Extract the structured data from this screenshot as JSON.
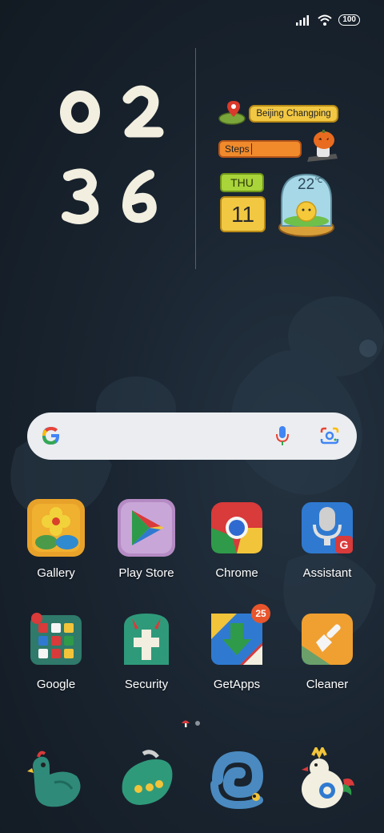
{
  "status_bar": {
    "battery": "100"
  },
  "clock": {
    "digits": [
      "0",
      "2",
      "3",
      "6"
    ]
  },
  "widgets": {
    "location": "Beijing Changping",
    "steps_label": "Steps",
    "weekday": "THU",
    "date": "11",
    "temperature": "22",
    "temperature_unit": "℃"
  },
  "apps": [
    {
      "label": "Gallery"
    },
    {
      "label": "Play Store"
    },
    {
      "label": "Chrome"
    },
    {
      "label": "Assistant"
    },
    {
      "label": "Google"
    },
    {
      "label": "Security"
    },
    {
      "label": "GetApps",
      "badge": "25"
    },
    {
      "label": "Cleaner"
    }
  ],
  "colors": {
    "widget_yellow": "#f2c843",
    "widget_orange": "#f08a2b",
    "widget_green": "#a9d43a",
    "badge": "#e8552c"
  }
}
